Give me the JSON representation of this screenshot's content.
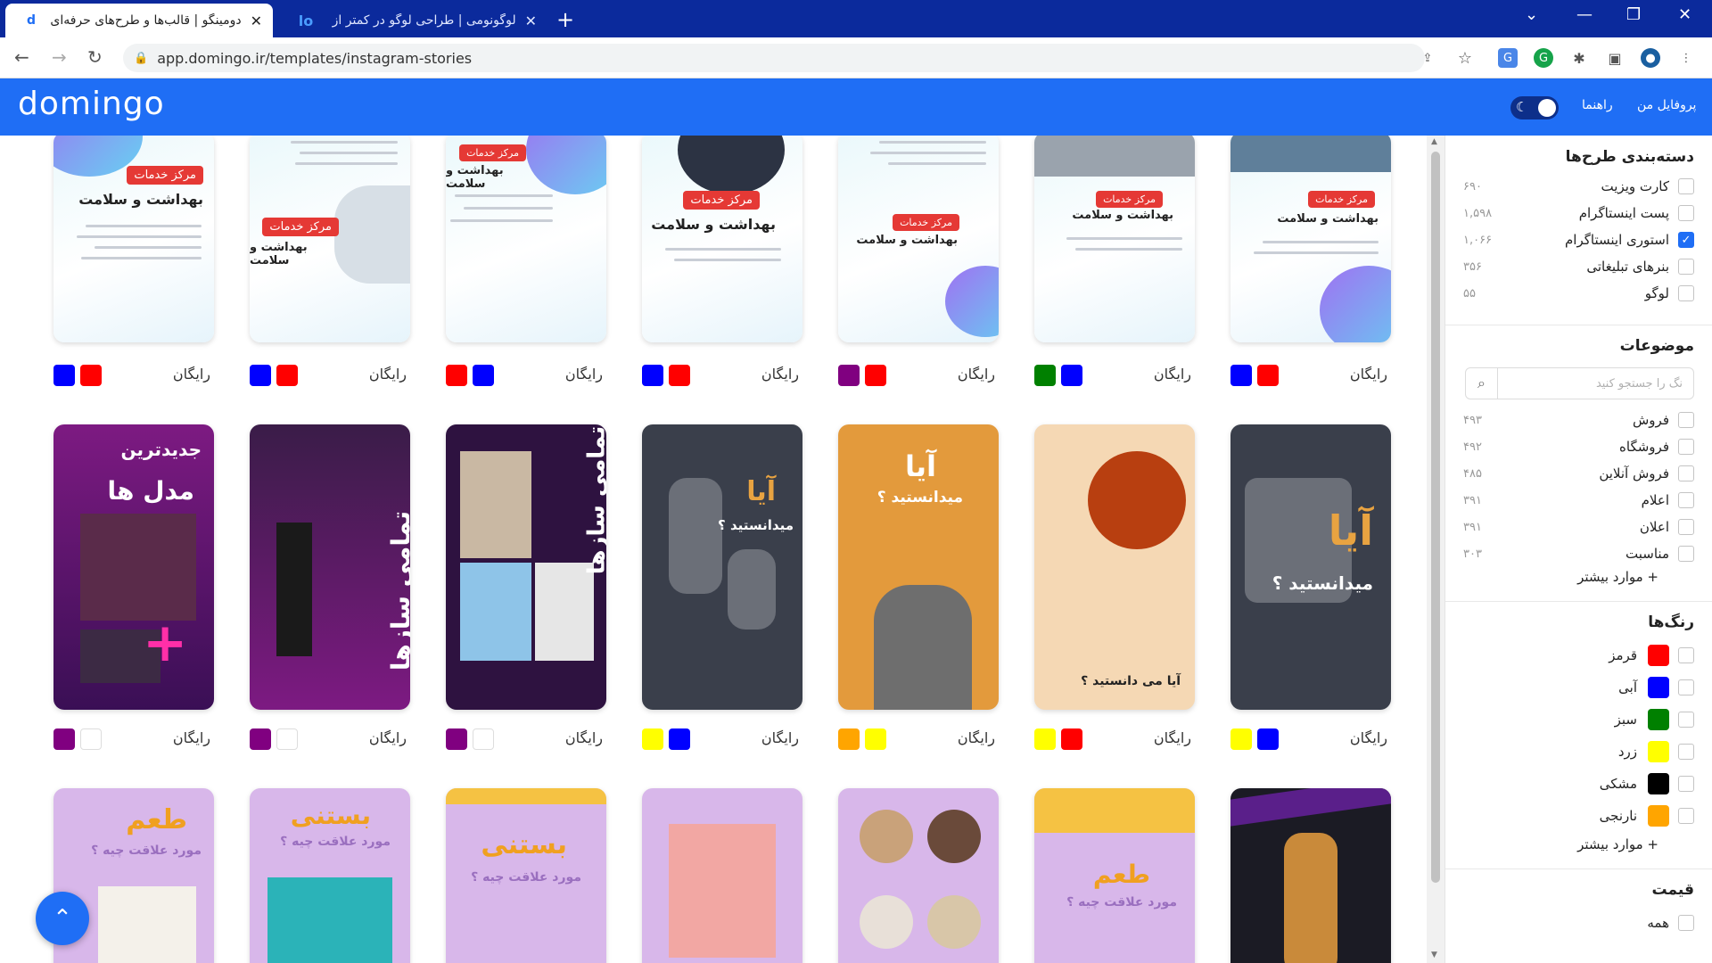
{
  "browser": {
    "tabs": [
      {
        "title": "دومینگو | قالب‌ها و طرح‌های حرفه‌ای",
        "favicon": "d",
        "active": true
      },
      {
        "title": "لوگونومی | طراحی لوگو در کمتر از",
        "favicon": "lo",
        "active": false
      }
    ],
    "url": "app.domingo.ir/templates/instagram-stories",
    "new_tab": "+"
  },
  "header": {
    "logo": "domingo",
    "profile": "پروفایل من",
    "guide": "راهنما"
  },
  "cards": {
    "free_label": "رایگان",
    "med_badge": "مرکز خدمات",
    "med_title": "بهداشت و سلامت",
    "did_you_know_1": "آیا",
    "did_you_know_2": "میدانستید ؟",
    "newest_1": "جدیدترین",
    "newest_2": "مدل ها",
    "instruments": "تمامی سازها",
    "icecream_1": "طعم",
    "icecream_2": "بستنی",
    "fav": "مورد علاقت چیه ؟"
  },
  "swatches": [
    [
      "#ff0000",
      "#0000ff"
    ],
    [
      "#0000ff",
      "#008000"
    ],
    [
      "#ff0000",
      "#800080"
    ],
    [
      "#ff0000",
      "#0000ff"
    ],
    [
      "#0000ff",
      "#ff0000"
    ],
    [
      "#ff0000",
      "#0000ff"
    ],
    [
      "#ff0000",
      "#0000ff"
    ],
    [
      "#0000ff",
      "#ffff00"
    ],
    [
      "#ff0000",
      "#ffff00"
    ],
    [
      "#ffff00",
      "#ffa500"
    ],
    [
      "#0000ff",
      "#ffff00"
    ],
    [
      "#ffffff",
      "#800080"
    ],
    [
      "#ffffff",
      "#800080"
    ],
    [
      "#ffffff",
      "#800080"
    ]
  ],
  "sidebar": {
    "categories_title": "دسته‌بندی طرح‌ها",
    "categories": [
      {
        "label": "کارت ویزیت",
        "count": "۶۹۰",
        "checked": false
      },
      {
        "label": "پست اینستاگرام",
        "count": "۱,۵۹۸",
        "checked": false
      },
      {
        "label": "استوری اینستاگرام",
        "count": "۱,۰۶۶",
        "checked": true
      },
      {
        "label": "بنرهای تبلیغاتی",
        "count": "۳۵۶",
        "checked": false
      },
      {
        "label": "لوگو",
        "count": "۵۵",
        "checked": false
      }
    ],
    "topics_title": "موضوعات",
    "search_placeholder": "نگ را جستجو کنید",
    "topics": [
      {
        "label": "فروش",
        "count": "۴۹۳"
      },
      {
        "label": "فروشگاه",
        "count": "۴۹۲"
      },
      {
        "label": "فروش آنلاین",
        "count": "۴۸۵"
      },
      {
        "label": "اعلام",
        "count": "۳۹۱"
      },
      {
        "label": "اعلان",
        "count": "۳۹۱"
      },
      {
        "label": "مناسبت",
        "count": "۳۰۳"
      }
    ],
    "more": "+ موارد بیشتر",
    "colors_title": "رنگ‌ها",
    "colors": [
      {
        "label": "قرمز",
        "hex": "#ff0000"
      },
      {
        "label": "آبی",
        "hex": "#0000ff"
      },
      {
        "label": "سبز",
        "hex": "#008000"
      },
      {
        "label": "زرد",
        "hex": "#ffff00"
      },
      {
        "label": "مشکی",
        "hex": "#000000"
      },
      {
        "label": "نارنجی",
        "hex": "#ffa500"
      }
    ],
    "price_title": "قیمت",
    "price_all": "همه"
  }
}
